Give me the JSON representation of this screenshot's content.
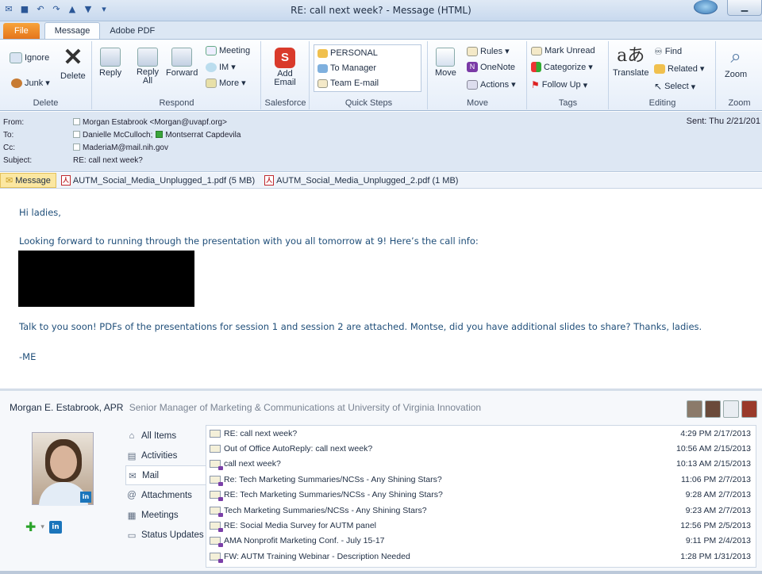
{
  "window": {
    "title": "RE: call next week? - Message (HTML)"
  },
  "tabs": [
    "File",
    "Message",
    "Adobe PDF"
  ],
  "ribbon": {
    "delete": {
      "ignore": "Ignore",
      "junk": "Junk",
      "delete": "Delete",
      "label": "Delete"
    },
    "respond": {
      "reply": "Reply",
      "reply_all": "Reply All",
      "forward": "Forward",
      "meeting": "Meeting",
      "im": "IM",
      "more": "More",
      "label": "Respond"
    },
    "salesforce": {
      "add_email": "Add Email",
      "label": "Salesforce"
    },
    "quick_steps": {
      "items": [
        "PERSONAL",
        "To Manager",
        "Team E-mail"
      ],
      "label": "Quick Steps"
    },
    "move": {
      "move": "Move",
      "rules": "Rules",
      "onenote": "OneNote",
      "actions": "Actions",
      "label": "Move"
    },
    "tags": {
      "mark_unread": "Mark Unread",
      "categorize": "Categorize",
      "follow_up": "Follow Up",
      "label": "Tags"
    },
    "editing": {
      "translate": "Translate",
      "find": "Find",
      "related": "Related",
      "select": "Select",
      "label": "Editing"
    },
    "zoom": {
      "zoom": "Zoom",
      "label": "Zoom"
    }
  },
  "header": {
    "from_label": "From:",
    "from": "Morgan Estabrook <Morgan@uvapf.org>",
    "to_label": "To:",
    "to_1": "Danielle McCulloch;",
    "to_2": "Montserrat Capdevila",
    "cc_label": "Cc:",
    "cc": "MaderiaM@mail.nih.gov",
    "subject_label": "Subject:",
    "subject": "RE: call next week?",
    "sent": "Sent:  Thu 2/21/201"
  },
  "attachments": {
    "message": "Message",
    "files": [
      "AUTM_Social_Media_Unplugged_1.pdf (5 MB)",
      "AUTM_Social_Media_Unplugged_2.pdf (1 MB)"
    ]
  },
  "body": {
    "greeting": "Hi ladies,",
    "para1": "Looking forward to running through the presentation with you all tomorrow at 9! Here’s the call info:",
    "para2": "Talk to you soon! PDFs of the presentations for session 1 and session 2 are attached. Montse, did you have additional slides to share? Thanks, ladies.",
    "signoff": "-ME"
  },
  "social": {
    "name": "Morgan E. Estabrook, APR",
    "title": "Senior Manager of Marketing & Communications at University of Virginia Innovation",
    "menu": [
      "All Items",
      "Activities",
      "Mail",
      "Attachments",
      "Meetings",
      "Status Updates"
    ],
    "selected_menu": "Mail",
    "linkedin_badge": "in",
    "mails": [
      {
        "subject": "RE: call next week?",
        "date": "4:29 PM 2/17/2013"
      },
      {
        "subject": "Out of Office AutoReply: call next week?",
        "date": "10:56 AM 2/15/2013"
      },
      {
        "subject": "call next week?",
        "date": "10:13 AM 2/15/2013"
      },
      {
        "subject": "Re: Tech Marketing Summaries/NCSs - Any Shining Stars?",
        "date": "11:06 PM 2/7/2013"
      },
      {
        "subject": "RE: Tech Marketing Summaries/NCSs - Any Shining Stars?",
        "date": "9:28 AM 2/7/2013"
      },
      {
        "subject": "Tech Marketing Summaries/NCSs - Any Shining Stars?",
        "date": "9:23 AM 2/7/2013"
      },
      {
        "subject": "RE: Social Media Survey for AUTM panel",
        "date": "12:56 PM 2/5/2013"
      },
      {
        "subject": "AMA Nonprofit Marketing Conf. - July 15-17",
        "date": "9:11 PM 2/4/2013"
      },
      {
        "subject": "FW: AUTM Training Webinar - Description Needed",
        "date": "1:28 PM 1/31/2013"
      }
    ]
  },
  "colors": {
    "file_tab": "#e5751c",
    "body_text": "#1f4e79",
    "header_bg": "#dde7f3"
  }
}
